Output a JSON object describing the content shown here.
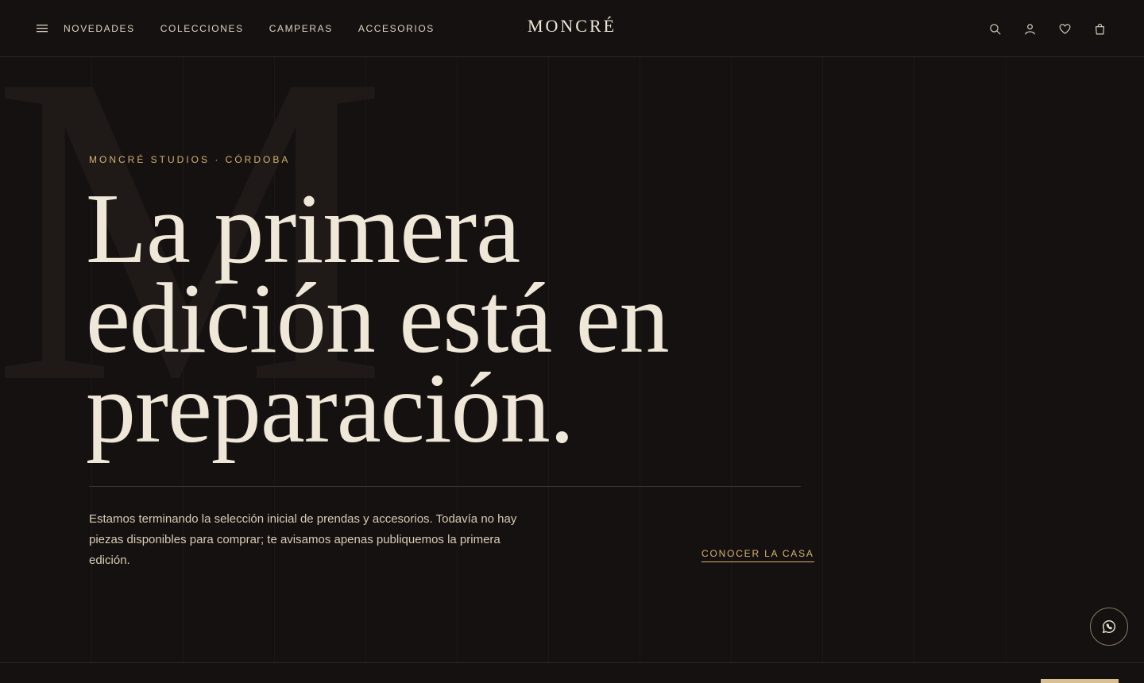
{
  "header": {
    "logo": "MONCRÉ",
    "nav": [
      "NOVEDADES",
      "COLECCIONES",
      "CAMPERAS",
      "ACCESORIOS"
    ],
    "icons": [
      "search-icon",
      "account-icon",
      "heart-icon",
      "bag-icon"
    ]
  },
  "hero": {
    "background_letter": "M",
    "eyebrow": "MONCRÉ STUDIOS · CÓRDOBA",
    "headline_lines": [
      "La primera",
      "edición está en",
      "preparación."
    ],
    "lead": "Estamos terminando la selección inicial de prendas y accesorios. Todavía no hay piezas disponibles para comprar; te avisamos apenas publiquemos la primera edición.",
    "cta": "CONOCER LA CASA"
  },
  "floating": {
    "icon": "whatsapp-icon"
  },
  "colors": {
    "background": "#151110",
    "text": "#efe7d8",
    "accent": "#d4b170",
    "muted": "#d8cbb6"
  }
}
